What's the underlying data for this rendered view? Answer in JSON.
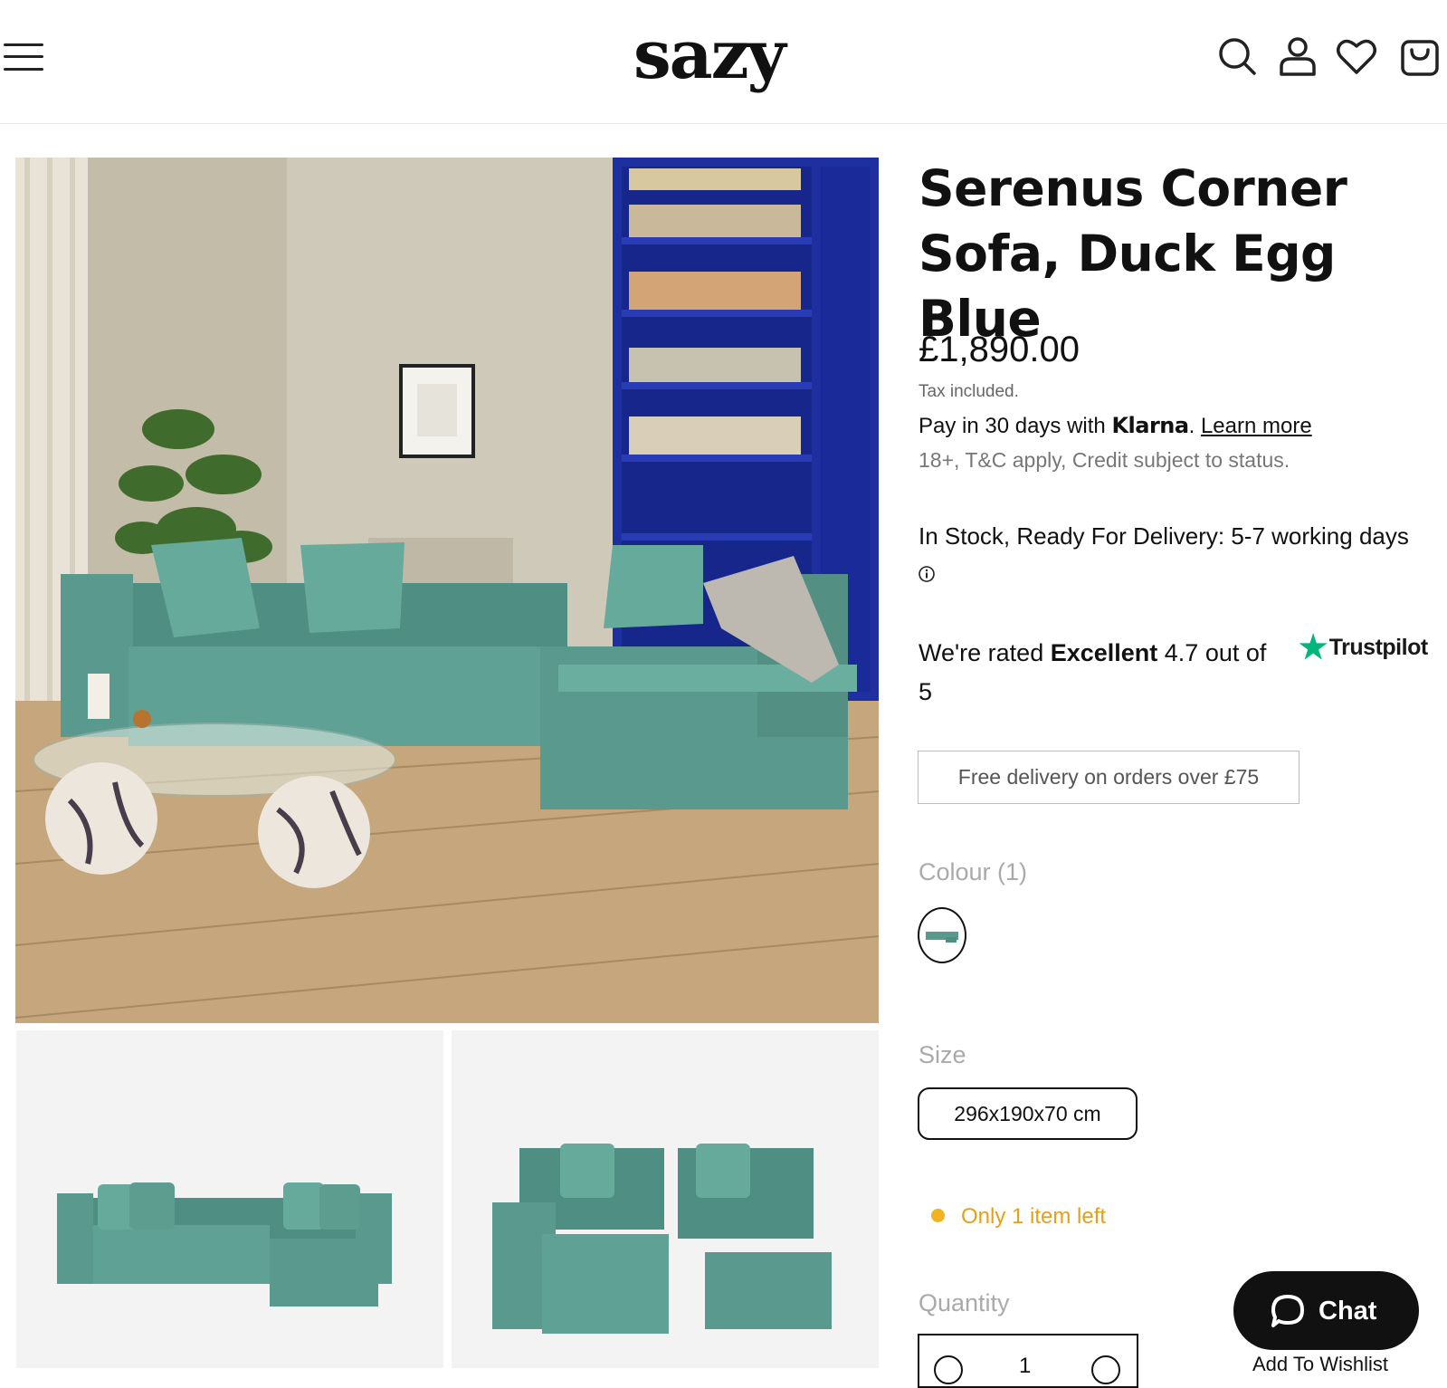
{
  "header": {
    "logo": "sazy",
    "icons": [
      "menu-icon",
      "search-icon",
      "account-icon",
      "heart-icon",
      "bag-icon"
    ]
  },
  "product": {
    "title": "Serenus Corner Sofa, Duck Egg Blue",
    "price": "£1,890.00",
    "tax_note": "Tax included.",
    "klarna": {
      "prefix": "Pay in 30 days with ",
      "brand": "Klarna",
      "suffix": ".",
      "link": "Learn more"
    },
    "terms": "18+, T&C apply, Credit subject to status.",
    "stock_status": "In Stock, Ready For Delivery: 5-7 working days",
    "rating": {
      "prefix": "We're rated ",
      "word": "Excellent",
      "suffix": " 4.7 out of 5",
      "brand": "Trustpilot"
    },
    "delivery_banner": "Free delivery on orders over £75",
    "colour_label": "Colour (1)",
    "size_label": "Size",
    "size_value": "296x190x70 cm",
    "stock_left": "Only 1 item left",
    "quantity_label": "Quantity",
    "quantity_value": "1",
    "wishlist": "Add To Wishlist"
  },
  "chat": {
    "label": "Chat"
  },
  "colors": {
    "accent_teal": "#5a9a8e",
    "stock_warning": "#e3a11a",
    "trustpilot_green": "#00b67a",
    "bookshelf_blue": "#1e2fa0"
  }
}
